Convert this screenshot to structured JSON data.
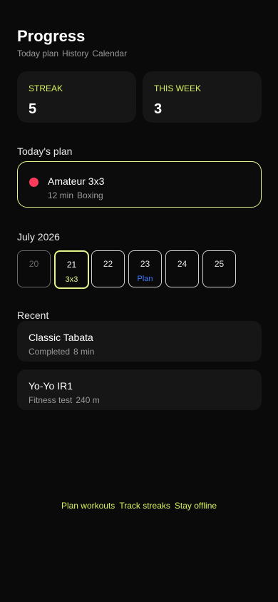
{
  "header": {
    "title": "Progress",
    "nav": [
      "Today plan",
      "History",
      "Calendar"
    ]
  },
  "stats": {
    "streak": {
      "label": "STREAK",
      "value": "5"
    },
    "this_week": {
      "label": "THIS WEEK",
      "value": "3"
    }
  },
  "todays_plan": {
    "heading": "Today's plan",
    "name": "Amateur 3x3",
    "duration": "12 min",
    "category": "Boxing",
    "dot_color": "#ff3b5c"
  },
  "calendar": {
    "month": "July 2026",
    "days": [
      {
        "num": "20",
        "tag": ""
      },
      {
        "num": "21",
        "tag": "3x3"
      },
      {
        "num": "22",
        "tag": ""
      },
      {
        "num": "23",
        "tag": "Plan"
      },
      {
        "num": "24",
        "tag": ""
      },
      {
        "num": "25",
        "tag": ""
      }
    ]
  },
  "recent": {
    "heading": "Recent",
    "items": [
      {
        "name": "Classic Tabata",
        "status": "Completed",
        "detail": "8 min"
      },
      {
        "name": "Yo-Yo IR1",
        "status": "Fitness test",
        "detail": "240 m"
      }
    ]
  },
  "footer": [
    "Plan workouts",
    "Track streaks",
    "Stay offline"
  ],
  "colors": {
    "accent": "#e6f28c",
    "plan_blue": "#3a7bff",
    "background": "#0a0a0a"
  }
}
